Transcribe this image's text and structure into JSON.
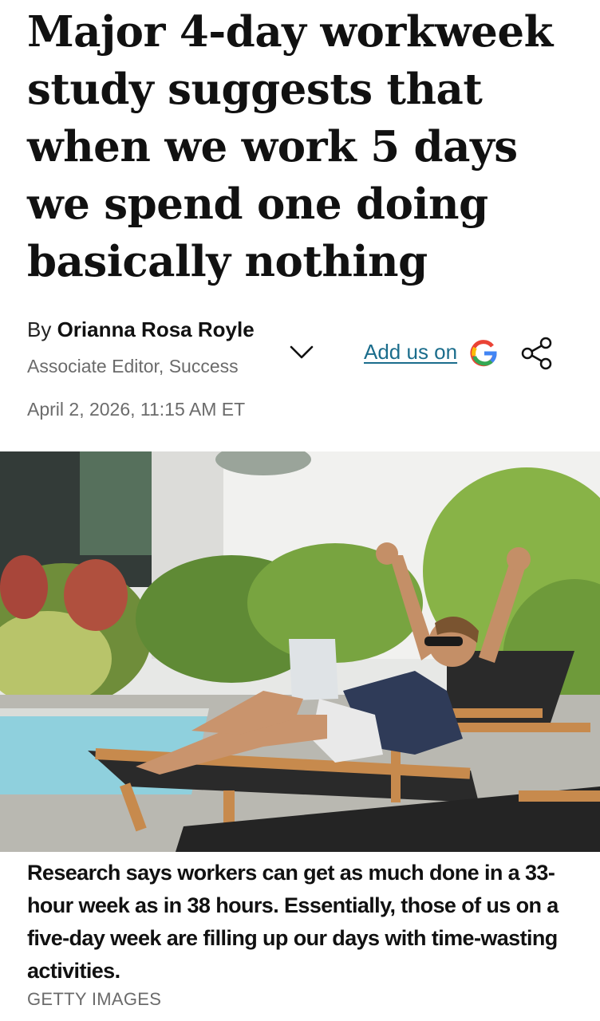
{
  "article": {
    "headline": "Major 4-day workweek study suggests that when we work 5 days we spend one doing basically nothing",
    "byline_prefix": "By ",
    "author_name": "Orianna Rosa Royle",
    "author_title": "Associate Editor, Success",
    "date": "April 2, 2026, 11:15 AM ET"
  },
  "actions": {
    "add_us_label": "Add us on",
    "google_icon": "google-icon",
    "share_icon": "share-icon",
    "expand_icon": "chevron-down-icon"
  },
  "image": {
    "caption": "Research says workers can get as much done in a 33-hour week as in 38 hours. Essentially, those of us on a five-day week are filling up our days with time-wasting activities.",
    "credit": "GETTY IMAGES"
  },
  "colors": {
    "link": "#1b6d8c",
    "muted_text": "#6b6b6b"
  }
}
